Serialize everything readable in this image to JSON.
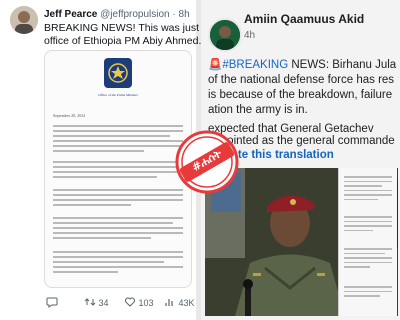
{
  "left_post": {
    "author_name": "Jeff Pearce",
    "handle": "@jeffpropulsion",
    "separator": "·",
    "time": "8h",
    "text_line1": "BREAKING NEWS! This was just relea",
    "text_line2": "office of Ethiopia PM Abiy Ahmed.",
    "document": {
      "letterhead_line1": "Office of the Prime Minister",
      "date": "September 20, 2024"
    },
    "actions": {
      "retweets": "34",
      "likes": "103",
      "views": "43K"
    }
  },
  "right_post": {
    "author_name": "Amiin Qaamuus Akid",
    "time": "4h",
    "breaking_emoji": "🚨",
    "hashtag": "#BREAKING",
    "line1_rest": " NEWS: Birhanu Jula",
    "line2": "of the national defense force has res",
    "line3": "is because of the breakdown, failure",
    "line4": "ation the army is in.",
    "line5": "expected that General Getachev",
    "line6": "appointed as the general commande",
    "translate_icon": "translate-icon",
    "rate_label": "Rate this translation"
  },
  "stamp": {
    "text": "#ሐሰት"
  },
  "colors": {
    "link_blue": "#1565c0",
    "stamp_red": "#e83a3a"
  }
}
